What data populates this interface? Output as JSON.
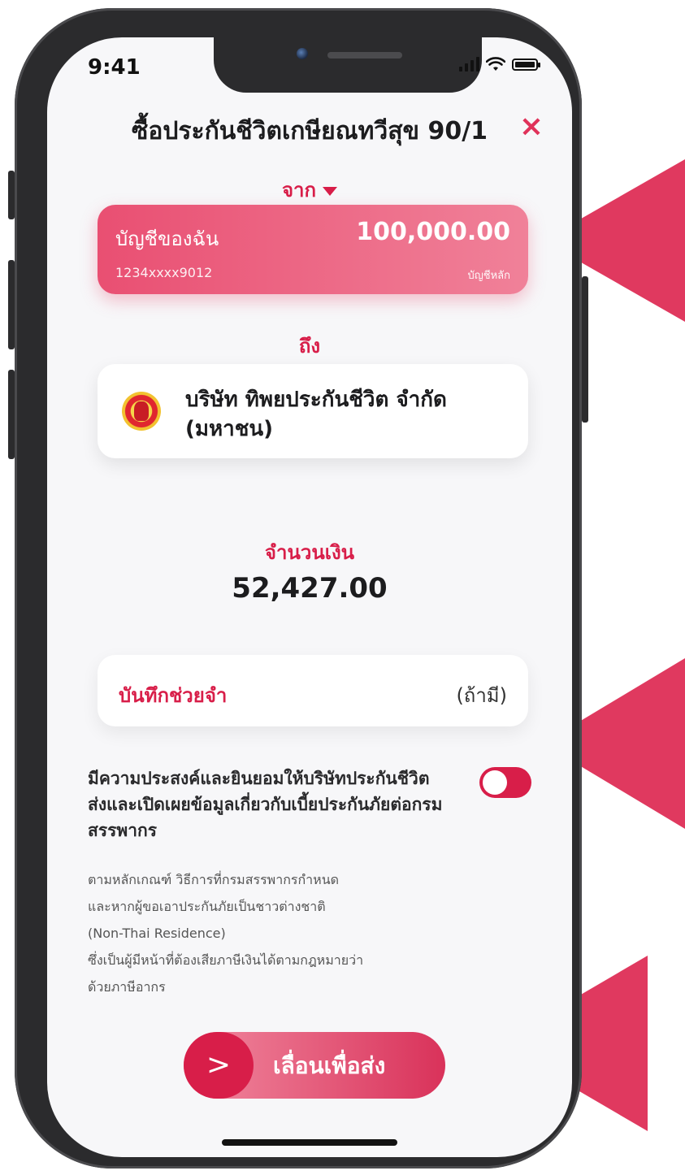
{
  "status": {
    "time": "9:41"
  },
  "header": {
    "title": "ซื้อประกันชีวิตเกษียณทวีสุข 90/1",
    "close_icon": "×"
  },
  "from": {
    "label": "จาก"
  },
  "account": {
    "name": "บัญชีของฉัน",
    "balance": "100,000.00",
    "number": "1234xxxx9012",
    "type": "บัญชีหลัก"
  },
  "to": {
    "label": "ถึง",
    "payee_name": "บริษัท ทิพยประกันชีวิต จำกัด (มหาชน)"
  },
  "amount": {
    "label": "จำนวนเงิน",
    "value": "52,427.00"
  },
  "memo": {
    "label": "บันทึกช่วยจำ",
    "optional": "(ถ้ามี)"
  },
  "consent": {
    "text": "มีความประสงค์และยินยอมให้บริษัทประกันชีวิตส่งและเปิดเผยข้อมูลเกี่ยวกับเบี้ยประกันภัยต่อกรมสรรพากร",
    "toggle_on": true
  },
  "note": {
    "line1": "ตามหลักเกณฑ์ วิธีการที่กรมสรรพากรกำหนด",
    "line2": "และหากผู้ขอเอาประกันภัยเป็นชาวต่างชาติ",
    "line3": "(Non-Thai Residence)",
    "line4": "ซึ่งเป็นผู้มีหน้าที่ต้องเสียภาษีเงินได้ตามกฎหมายว่า",
    "line5": "ด้วยภาษีอากร"
  },
  "slide": {
    "label": "เลื่อนเพื่อส่ง",
    "knob_icon": ">"
  },
  "colors": {
    "accent": "#d81e49",
    "arrow": "#e0395f",
    "phone": "#2b2b2d"
  }
}
